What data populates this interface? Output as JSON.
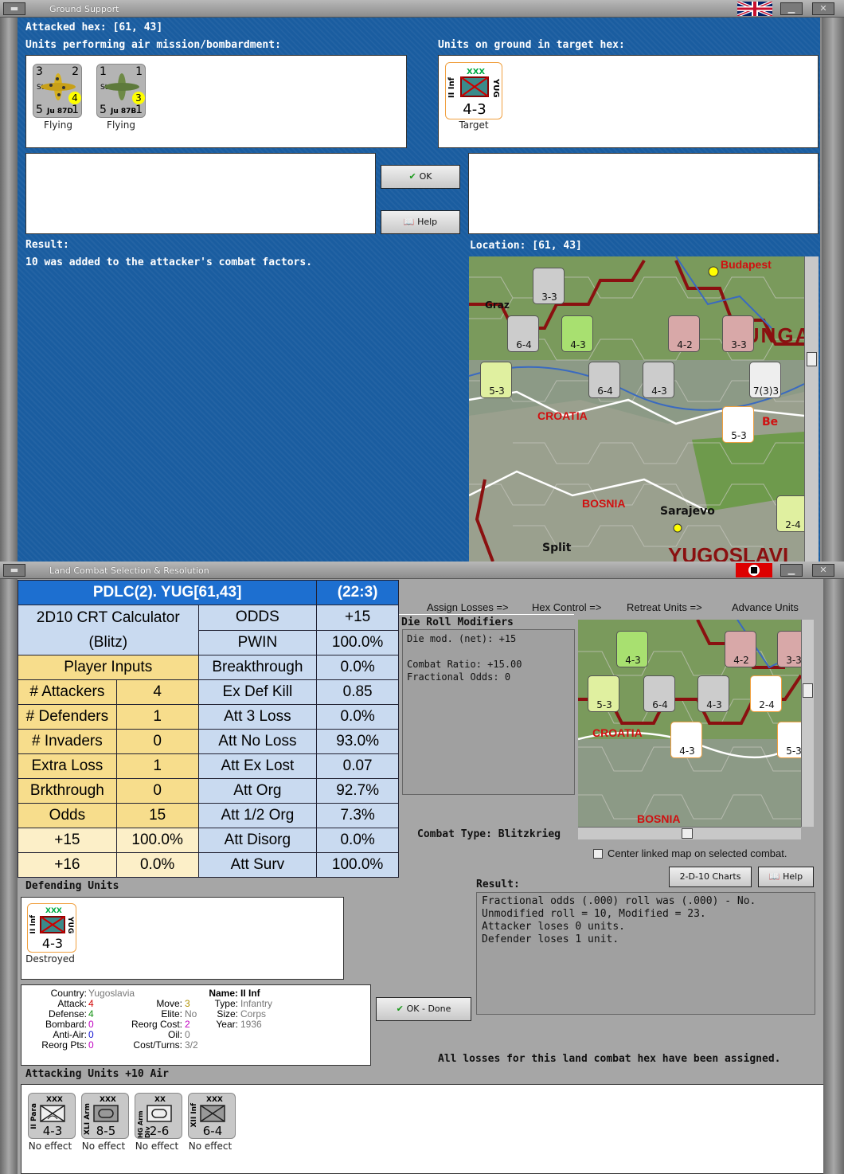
{
  "top": {
    "title": "Ground Support",
    "attacked_hex": "Attacked hex: [61, 43]",
    "air_units_label": "Units performing air mission/bombardment:",
    "ground_units_label": "Units on ground in target hex:",
    "air_units": [
      {
        "name": "Stuka",
        "model": "Ju 87D",
        "tl": "3",
        "tr": "2",
        "bl": "5",
        "br": "1",
        "badge": "4",
        "status": "Flying"
      },
      {
        "name": "Stuka",
        "model": "Ju 87B",
        "tl": "1",
        "tr": "1",
        "bl": "5",
        "br": "1",
        "badge": "3",
        "status": "Flying"
      }
    ],
    "target_unit": {
      "size": "XXX",
      "name": "II Inf",
      "nation": "YUG",
      "value": "4-3",
      "status": "Target"
    },
    "ok_label": "OK",
    "help_label": "Help",
    "result_label": "Result:",
    "result_text": "10 was added to the attacker's combat factors.",
    "location_label": "Location:  [61, 43]",
    "map_labels": {
      "budapest": "Budapest",
      "graz": "Graz",
      "hungary": "HUNGARY",
      "croatia": "CROATIA",
      "bosnia": "BOSNIA",
      "sarajevo": "Sarajevo",
      "split": "Split",
      "yugoslavia": "YUGOSLAVI",
      "beo": "Be"
    },
    "map_units": [
      "6-4",
      "4-3",
      "4-2",
      "3-3",
      "3-3",
      "5-3",
      "6-4",
      "4-3",
      "7(3)3",
      "5-3",
      "2-4"
    ]
  },
  "bottom": {
    "title": "Land Combat Selection & Resolution",
    "crt": {
      "header": "PDLC(2).  YUG[61,43]",
      "header_right": "(22:3)",
      "calc_title": "2D10 CRT Calculator",
      "calc_sub": "(Blitz)",
      "player_inputs": "Player Inputs",
      "inputs": [
        [
          "# Attackers",
          "4"
        ],
        [
          "# Defenders",
          "1"
        ],
        [
          "# Invaders",
          "0"
        ],
        [
          "Extra Loss",
          "1"
        ],
        [
          "Brkthrough",
          "0"
        ],
        [
          "Odds",
          "15"
        ]
      ],
      "odds_rows": [
        [
          "+15",
          "100.0%"
        ],
        [
          "+16",
          "0.0%"
        ]
      ],
      "stats": [
        [
          "ODDS",
          "+15"
        ],
        [
          "PWIN",
          "100.0%"
        ],
        [
          "Breakthrough",
          "0.0%"
        ],
        [
          "Ex Def Kill",
          "0.85"
        ],
        [
          "Att 3 Loss",
          "0.0%"
        ],
        [
          "Att No Loss",
          "93.0%"
        ],
        [
          "Att Ex Lost",
          "0.07"
        ],
        [
          "Att Org",
          "92.7%"
        ],
        [
          "Att 1/2 Org",
          "7.3%"
        ],
        [
          "Att Disorg",
          "0.0%"
        ],
        [
          "Att Surv",
          "100.0%"
        ]
      ]
    },
    "steps": [
      "Assign Losses =>",
      "Hex Control =>",
      "Retreat Units =>",
      "Advance Units"
    ],
    "die_roll_label": "Die Roll Modifiers",
    "die_roll_lines": [
      "Die mod. (net): +15",
      "",
      "Combat Ratio: +15.00",
      "Fractional Odds: 0"
    ],
    "combat_type": "Combat Type:  Blitzkrieg",
    "center_map_label": "Center linked map on selected combat.",
    "charts_label": "2-D-10 Charts",
    "help_label": "Help",
    "result_label": "Result:",
    "result_lines": [
      "Fractional odds (.000) roll was (.000)  - No.",
      "Unmodified roll = 10, Modified = 23.",
      "Attacker loses 0 units.",
      "Defender loses 1 unit."
    ],
    "defending_label": "Defending Units",
    "defender": {
      "size": "XXX",
      "name": "II Inf",
      "nation": "YUG",
      "value": "4-3",
      "status": "Destroyed"
    },
    "info": {
      "country_k": "Country:",
      "country_v": "Yugoslavia",
      "attack_k": "Attack:",
      "attack_v": "4",
      "defense_k": "Defense:",
      "defense_v": "4",
      "bombard_k": "Bombard:",
      "bombard_v": "0",
      "antiair_k": "Anti-Air:",
      "antiair_v": "0",
      "reorgpts_k": "Reorg Pts:",
      "reorgpts_v": "0",
      "move_k": "Move:",
      "move_v": "3",
      "elite_k": "Elite:",
      "elite_v": "No",
      "reorgcost_k": "Reorg Cost:",
      "reorgcost_v": "2",
      "oil_k": "Oil:",
      "oil_v": "0",
      "costturns_k": "Cost/Turns:",
      "costturns_v": "3/2",
      "name_k": "Name:",
      "name_v": "II Inf",
      "type_k": "Type:",
      "type_v": "Infantry",
      "size_k": "Size:",
      "size_v": "Corps",
      "year_k": "Year:",
      "year_v": "1936"
    },
    "ok_done_label": "OK - Done",
    "all_losses": "All losses for this land combat hex have been assigned.",
    "attacking_label": "Attacking Units +10 Air",
    "attackers": [
      {
        "size": "XXX",
        "name": "II Para",
        "value": "4-3",
        "status": "No effect"
      },
      {
        "size": "XXX",
        "name": "XLI Arm",
        "value": "8-5",
        "status": "No effect"
      },
      {
        "size": "XX",
        "name": "HG Arm Div",
        "value": "2-6",
        "status": "No effect"
      },
      {
        "size": "XXX",
        "name": "XII Inf",
        "value": "6-4",
        "status": "No effect"
      }
    ],
    "minimap_labels": {
      "croatia": "CROATIA",
      "bosnia": "BOSNIA"
    },
    "minimap_units": [
      "4-3",
      "4-2",
      "3-3",
      "5-3",
      "6-4",
      "4-3",
      "2-4",
      "4-3",
      "5-3"
    ]
  },
  "colors": {
    "blue_panel": "#1a5da0",
    "crt_header": "#1d6fd0",
    "crt_light": "#c9daf0",
    "crt_yellow": "#f7dd8c",
    "crt_pale": "#fcefc8",
    "red_value": "#d00000",
    "green_value": "#109010"
  }
}
